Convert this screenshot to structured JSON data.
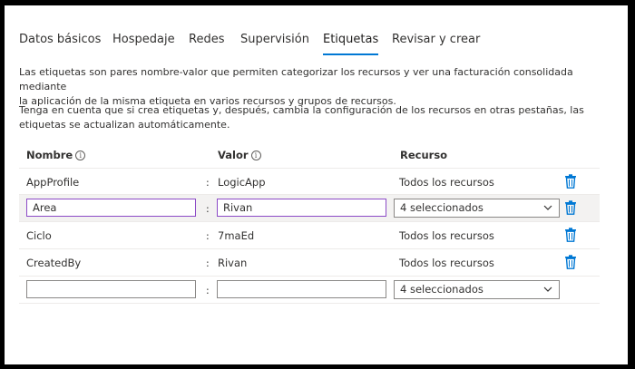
{
  "tabs": [
    {
      "label": "Datos básicos"
    },
    {
      "label": "Hospedaje"
    },
    {
      "label": "Redes"
    },
    {
      "label": "Supervisión"
    },
    {
      "label": "Etiquetas"
    },
    {
      "label": "Revisar y crear"
    }
  ],
  "active_tab": "Etiquetas",
  "description": {
    "line1": "Las etiquetas son pares nombre-valor que permiten categorizar los recursos y ver una facturación consolidada mediante",
    "line2": "la aplicación de la misma etiqueta en varios recursos y grupos de recursos.",
    "line3": "Tenga en cuenta que si crea etiquetas y, después, cambia la configuración de los recursos en otras pestañas, las",
    "line4": "etiquetas se actualizan automáticamente."
  },
  "columns": {
    "name": "Nombre",
    "value": "Valor",
    "resource": "Recurso",
    "info_glyph": "i"
  },
  "separator": ":",
  "rows": [
    {
      "name": "AppProfile",
      "value": "LogicApp",
      "resource": "Todos los recursos"
    },
    {
      "name": "Area",
      "value": "Rivan",
      "resource": "4 seleccionados"
    },
    {
      "name": "Ciclo",
      "value": "7maEd",
      "resource": "Todos los recursos"
    },
    {
      "name": "CreatedBy",
      "value": "Rivan",
      "resource": "Todos los recursos"
    },
    {
      "name": "",
      "value": "",
      "resource": "4 seleccionados"
    }
  ],
  "colors": {
    "accent": "#0078d4",
    "focus_border": "#8c4bc7",
    "delete_icon": "#0078d4",
    "highlight_row": "#f3f2f1"
  },
  "icons": {
    "delete": "trash-icon",
    "dropdown": "chevron-down-icon",
    "info": "info-icon"
  }
}
